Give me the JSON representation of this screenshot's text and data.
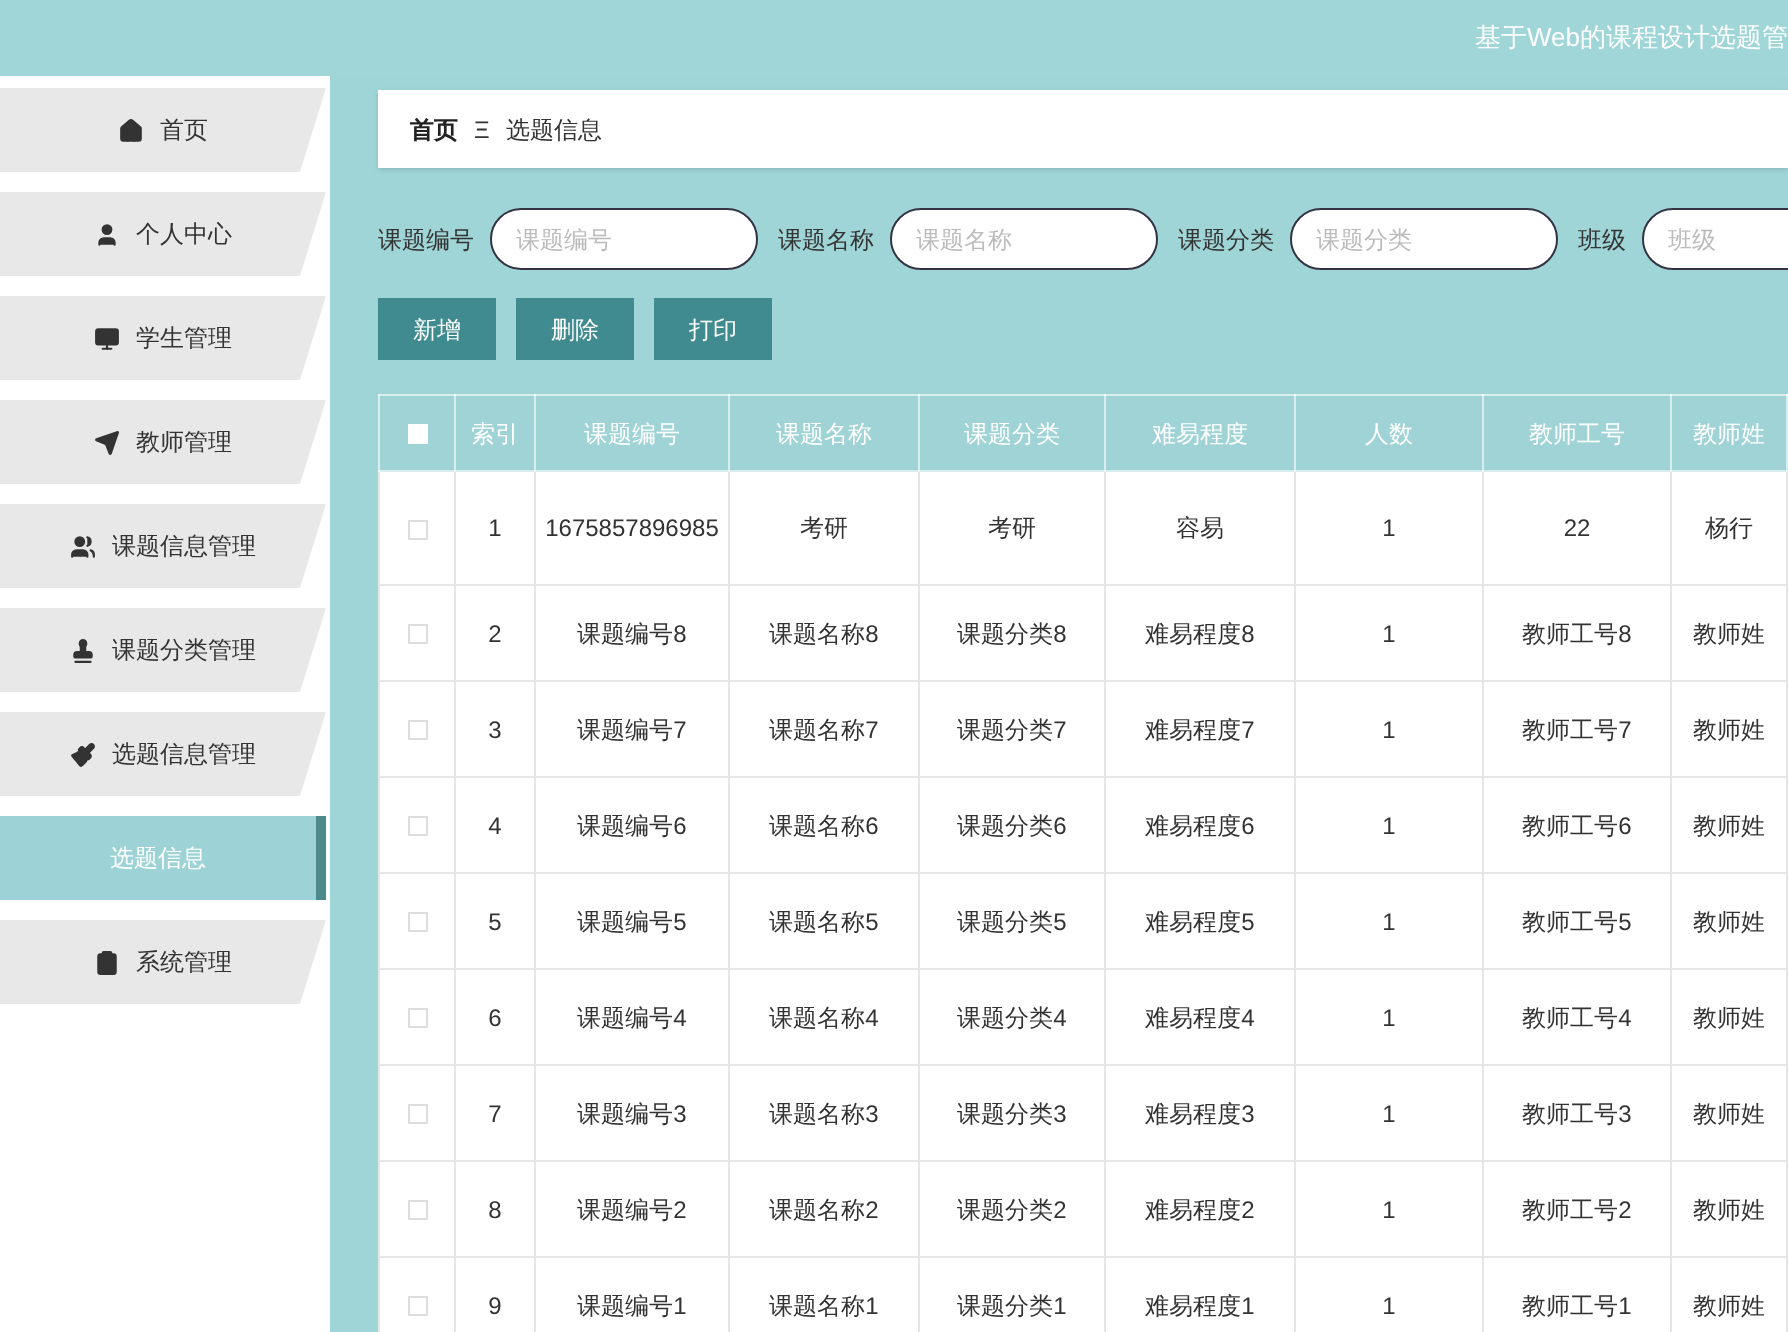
{
  "header": {
    "title": "基于Web的课程设计选题管"
  },
  "sidebar": {
    "items": [
      {
        "label": "首页",
        "selected": false
      },
      {
        "label": "个人中心",
        "selected": false
      },
      {
        "label": "学生管理",
        "selected": false
      },
      {
        "label": "教师管理",
        "selected": false
      },
      {
        "label": "课题信息管理",
        "selected": false
      },
      {
        "label": "课题分类管理",
        "selected": false
      },
      {
        "label": "选题信息管理",
        "selected": false
      },
      {
        "label": "选题信息",
        "selected": true
      },
      {
        "label": "系统管理",
        "selected": false
      }
    ]
  },
  "breadcrumb": {
    "home": "首页",
    "separator": "Ξ",
    "current": "选题信息"
  },
  "search": [
    {
      "label": "课题编号",
      "placeholder": "课题编号"
    },
    {
      "label": "课题名称",
      "placeholder": "课题名称"
    },
    {
      "label": "课题分类",
      "placeholder": "课题分类"
    },
    {
      "label": "班级",
      "placeholder": "班级"
    }
  ],
  "buttons": [
    "新增",
    "删除",
    "打印"
  ],
  "table": {
    "select_all": {
      "checked": false
    },
    "columns": [
      "索引",
      "课题编号",
      "课题名称",
      "课题分类",
      "难易程度",
      "人数",
      "教师工号",
      "教师姓"
    ],
    "rows": [
      {
        "checked": false,
        "cells": [
          "1",
          "1675857896985",
          "考研",
          "考研",
          "容易",
          "1",
          "22",
          "杨行"
        ]
      },
      {
        "checked": false,
        "cells": [
          "2",
          "课题编号8",
          "课题名称8",
          "课题分类8",
          "难易程度8",
          "1",
          "教师工号8",
          "教师姓"
        ]
      },
      {
        "checked": false,
        "cells": [
          "3",
          "课题编号7",
          "课题名称7",
          "课题分类7",
          "难易程度7",
          "1",
          "教师工号7",
          "教师姓"
        ]
      },
      {
        "checked": false,
        "cells": [
          "4",
          "课题编号6",
          "课题名称6",
          "课题分类6",
          "难易程度6",
          "1",
          "教师工号6",
          "教师姓"
        ]
      },
      {
        "checked": false,
        "cells": [
          "5",
          "课题编号5",
          "课题名称5",
          "课题分类5",
          "难易程度5",
          "1",
          "教师工号5",
          "教师姓"
        ]
      },
      {
        "checked": false,
        "cells": [
          "6",
          "课题编号4",
          "课题名称4",
          "课题分类4",
          "难易程度4",
          "1",
          "教师工号4",
          "教师姓"
        ]
      },
      {
        "checked": false,
        "cells": [
          "7",
          "课题编号3",
          "课题名称3",
          "课题分类3",
          "难易程度3",
          "1",
          "教师工号3",
          "教师姓"
        ]
      },
      {
        "checked": false,
        "cells": [
          "8",
          "课题编号2",
          "课题名称2",
          "课题分类2",
          "难易程度2",
          "1",
          "教师工号2",
          "教师姓"
        ]
      },
      {
        "checked": false,
        "cells": [
          "9",
          "课题编号1",
          "课题名称1",
          "课题分类1",
          "难易程度1",
          "1",
          "教师工号1",
          "教师姓"
        ]
      }
    ]
  }
}
